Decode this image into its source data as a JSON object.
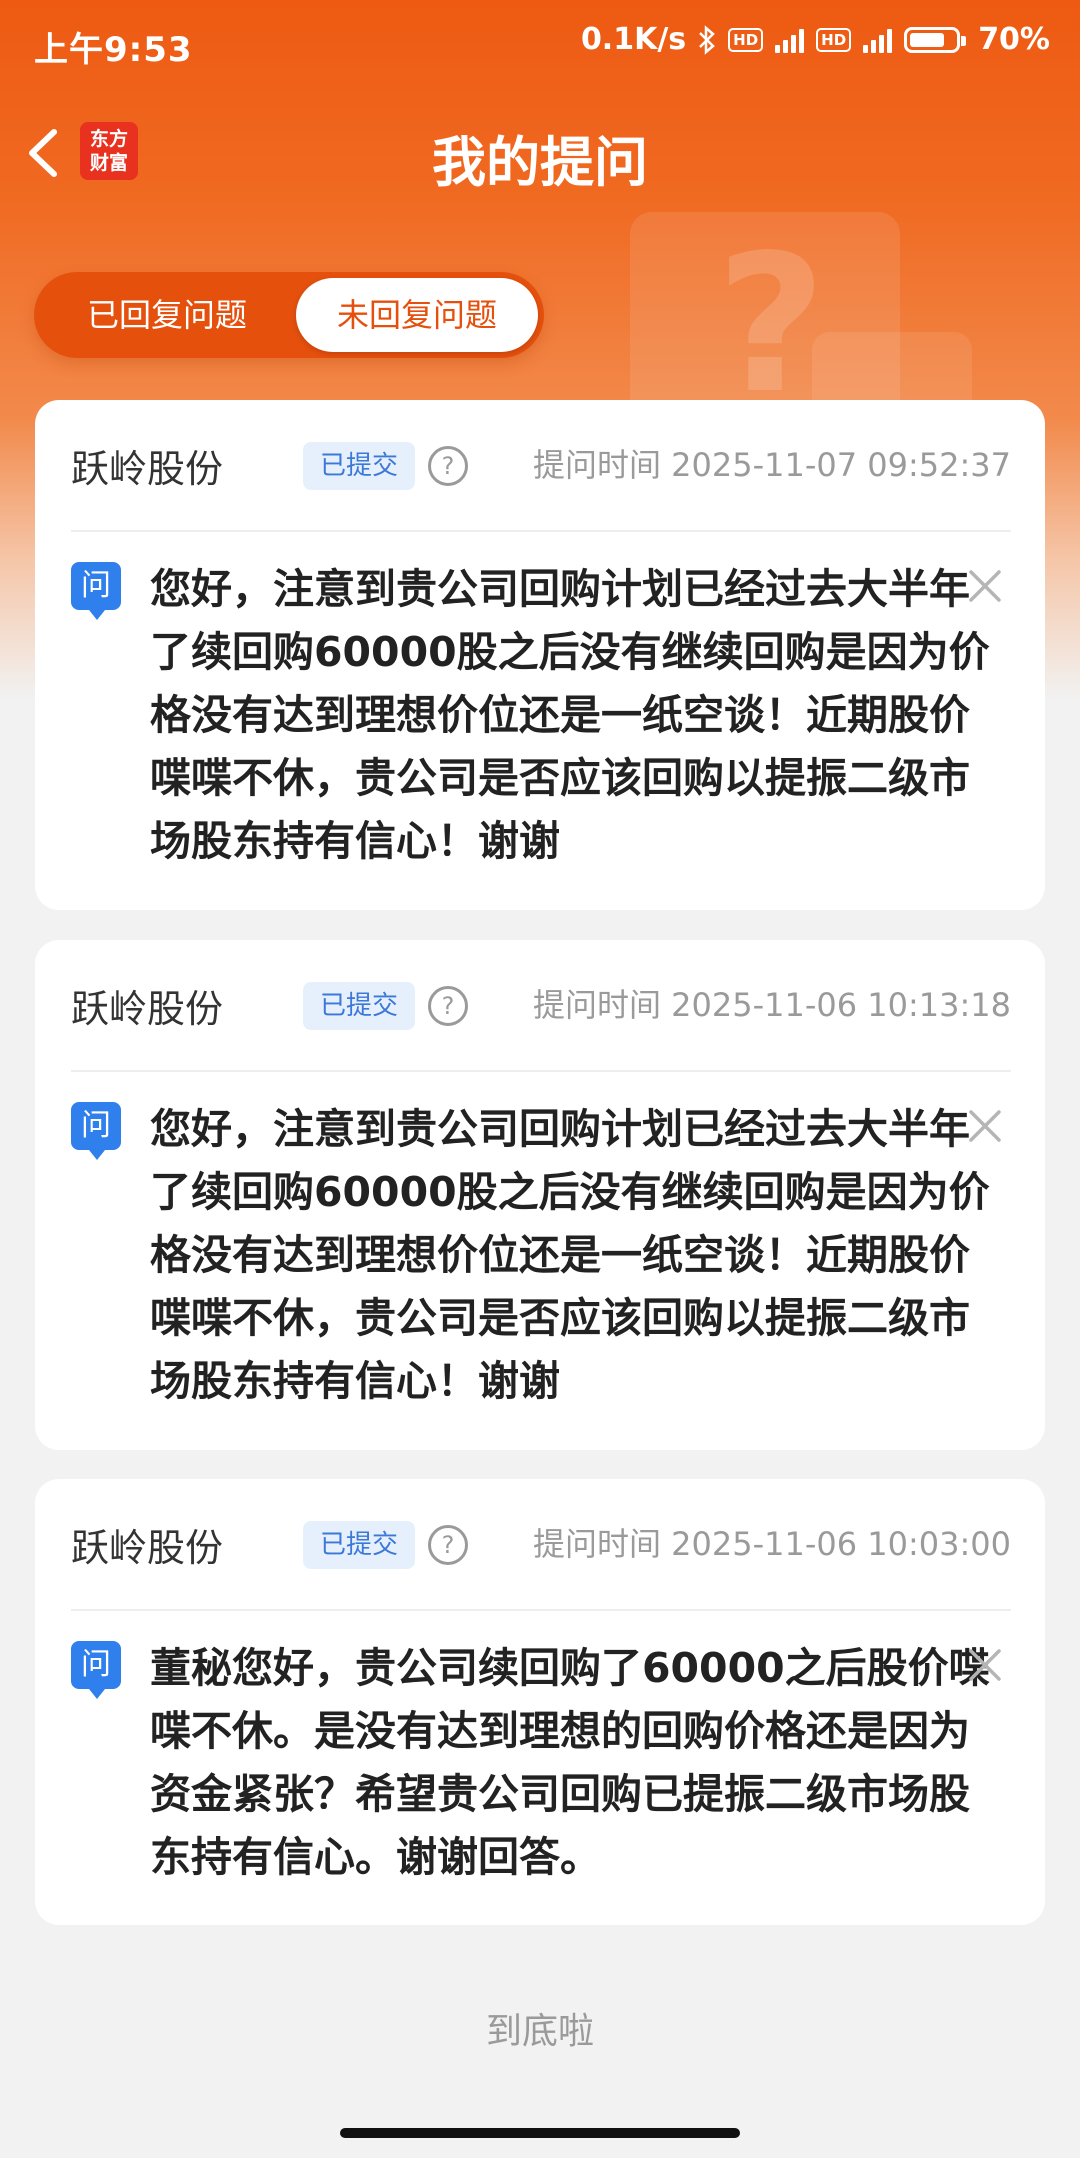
{
  "status_bar": {
    "time": "上午9:53",
    "net_speed": "0.1K/s",
    "battery": "70%",
    "icons": [
      "bluetooth-icon",
      "hd-icon",
      "signal-4g-icon",
      "hd-icon",
      "signal-4g-icon",
      "battery-icon"
    ]
  },
  "header": {
    "title": "我的提问",
    "logo_line1": "东方",
    "logo_line2": "财富",
    "back_icon": "chevron-left-icon"
  },
  "tabs": [
    {
      "label": "已回复问题",
      "selected": false
    },
    {
      "label": "未回复问题",
      "selected": true
    }
  ],
  "questions": [
    {
      "company": "跃岭股份",
      "status": "已提交",
      "time": "提问时间 2025-11-07 09:52:37",
      "icon_label": "问",
      "text": "您好，注意到贵公司回购计划已经过去大半年了续回购60000股之后没有继续回购是因为价格没有达到理想价位还是一纸空谈！近期股价喋喋不休，贵公司是否应该回购以提振二级市场股东持有信心！谢谢"
    },
    {
      "company": "跃岭股份",
      "status": "已提交",
      "time": "提问时间 2025-11-06 10:13:18",
      "icon_label": "问",
      "text": "您好，注意到贵公司回购计划已经过去大半年了续回购60000股之后没有继续回购是因为价格没有达到理想价位还是一纸空谈！近期股价喋喋不休，贵公司是否应该回购以提振二级市场股东持有信心！谢谢"
    },
    {
      "company": "跃岭股份",
      "status": "已提交",
      "time": "提问时间 2025-11-06 10:03:00",
      "icon_label": "问",
      "text": "董秘您好，贵公司续回购了60000之后股价喋喋不休。是没有达到理想的回购价格还是因为资金紧张？希望贵公司回购已提振二级市场股东持有信心。谢谢回答。"
    }
  ],
  "footer": {
    "end_text": "到底啦"
  },
  "colors": {
    "brand": "#ee5a12",
    "badge_text": "#3b78d8",
    "q_icon": "#2f80ed"
  }
}
